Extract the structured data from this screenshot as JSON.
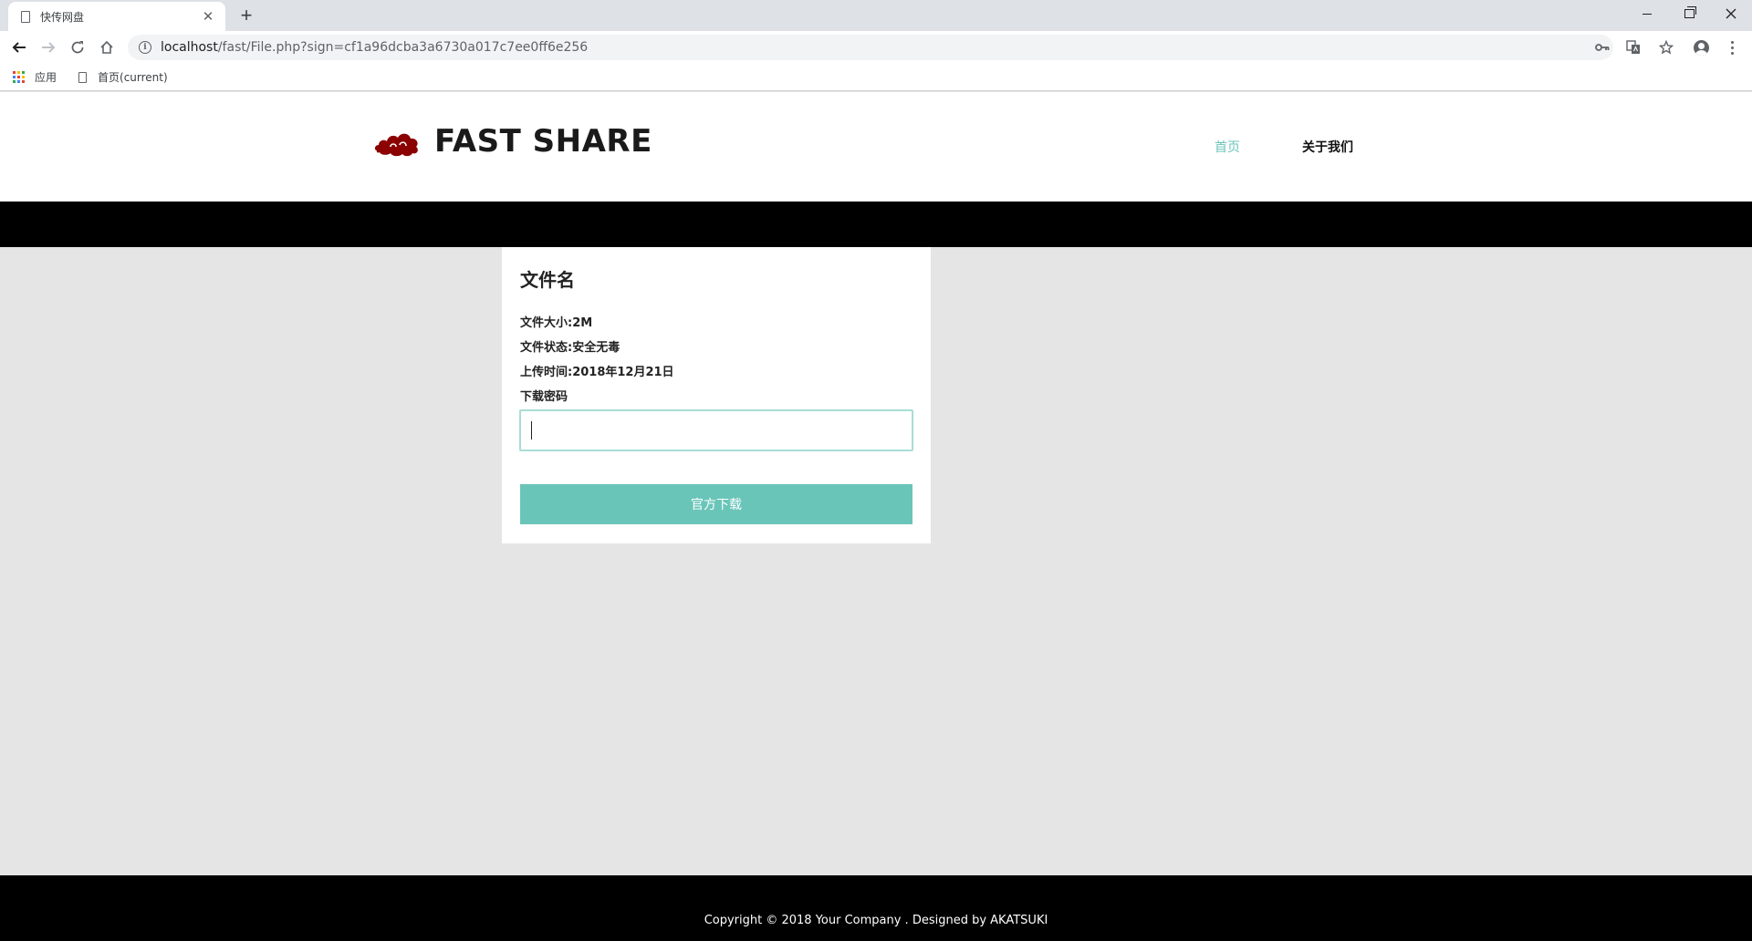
{
  "browser": {
    "tab_title": "快传网盘",
    "tab_close": "✕",
    "new_tab": "+",
    "url_host": "localhost",
    "url_path": "/fast/File.php?sign=cf1a96dcba3a6730a017c7ee0ff6e256",
    "bookmarks": {
      "apps_label": "应用",
      "items": [
        {
          "label": "首页(current)"
        }
      ]
    },
    "app_grid_colors": [
      "#ea4335",
      "#fbbc05",
      "#34a853",
      "#4285f4",
      "#ea4335",
      "#fbbc05",
      "#34a853",
      "#4285f4",
      "#ea4335"
    ]
  },
  "site": {
    "title": "FAST SHARE",
    "logo_color": "#8b0000",
    "nav": {
      "home": "首页",
      "about": "关于我们"
    },
    "accent_color": "#6ac5b9"
  },
  "file": {
    "name": "文件名",
    "size": "文件大小:2M",
    "status": "文件状态:安全无毒",
    "upload_time": "上传时间:2018年12月21日",
    "password_label": "下载密码",
    "password_value": "",
    "download_button": "官方下载"
  },
  "footer": {
    "copyright": "Copyright © 2018 Your Company . Designed by AKATSUKI"
  }
}
